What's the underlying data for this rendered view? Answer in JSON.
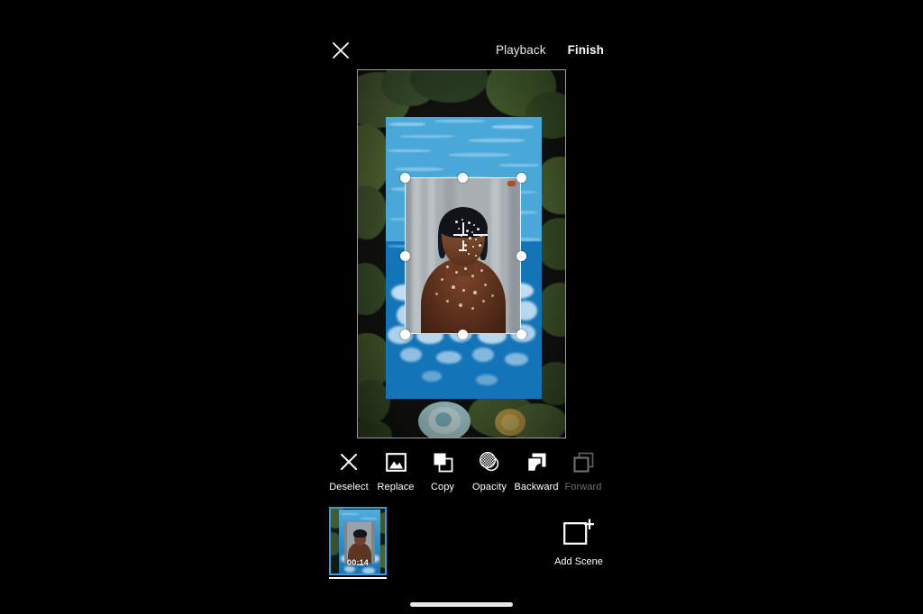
{
  "app": {
    "background_color": "#000000",
    "accent_color": "#3b9ad9"
  },
  "topbar": {
    "close_label": "close-icon",
    "actions": [
      {
        "label": "Playback",
        "name": "playback-button",
        "emphasis": "normal"
      },
      {
        "label": "Finish",
        "name": "finish-button",
        "emphasis": "bold"
      }
    ]
  },
  "canvas": {
    "name": "editor-canvas",
    "layers": [
      {
        "name": "background-image-layer",
        "description": "dark pond with lily pads"
      },
      {
        "name": "water-image-layer",
        "description": "blue pool water texture"
      },
      {
        "name": "portrait-image-layer",
        "description": "portrait of a person with face paint",
        "selected": true
      }
    ],
    "selection": {
      "handle_count": 8,
      "handle_color": "#ffffff"
    }
  },
  "toolbar": {
    "tools": [
      {
        "label": "Deselect",
        "icon": "close-icon",
        "name": "tool-deselect",
        "enabled": true
      },
      {
        "label": "Replace",
        "icon": "image-icon",
        "name": "tool-replace",
        "enabled": true
      },
      {
        "label": "Copy",
        "icon": "copy-icon",
        "name": "tool-copy",
        "enabled": true
      },
      {
        "label": "Opacity",
        "icon": "opacity-icon",
        "name": "tool-opacity",
        "enabled": true
      },
      {
        "label": "Backward",
        "icon": "send-backward-icon",
        "name": "tool-backward",
        "enabled": true
      },
      {
        "label": "Forward",
        "icon": "bring-forward-icon",
        "name": "tool-forward",
        "enabled": false
      }
    ]
  },
  "scenes": {
    "items": [
      {
        "name": "scene-thumbnail-1",
        "duration": "00:14",
        "selected": true
      }
    ],
    "add_scene": {
      "label": "Add Scene",
      "icon": "add-scene-icon"
    }
  },
  "system": {
    "home_indicator": "home-indicator"
  }
}
